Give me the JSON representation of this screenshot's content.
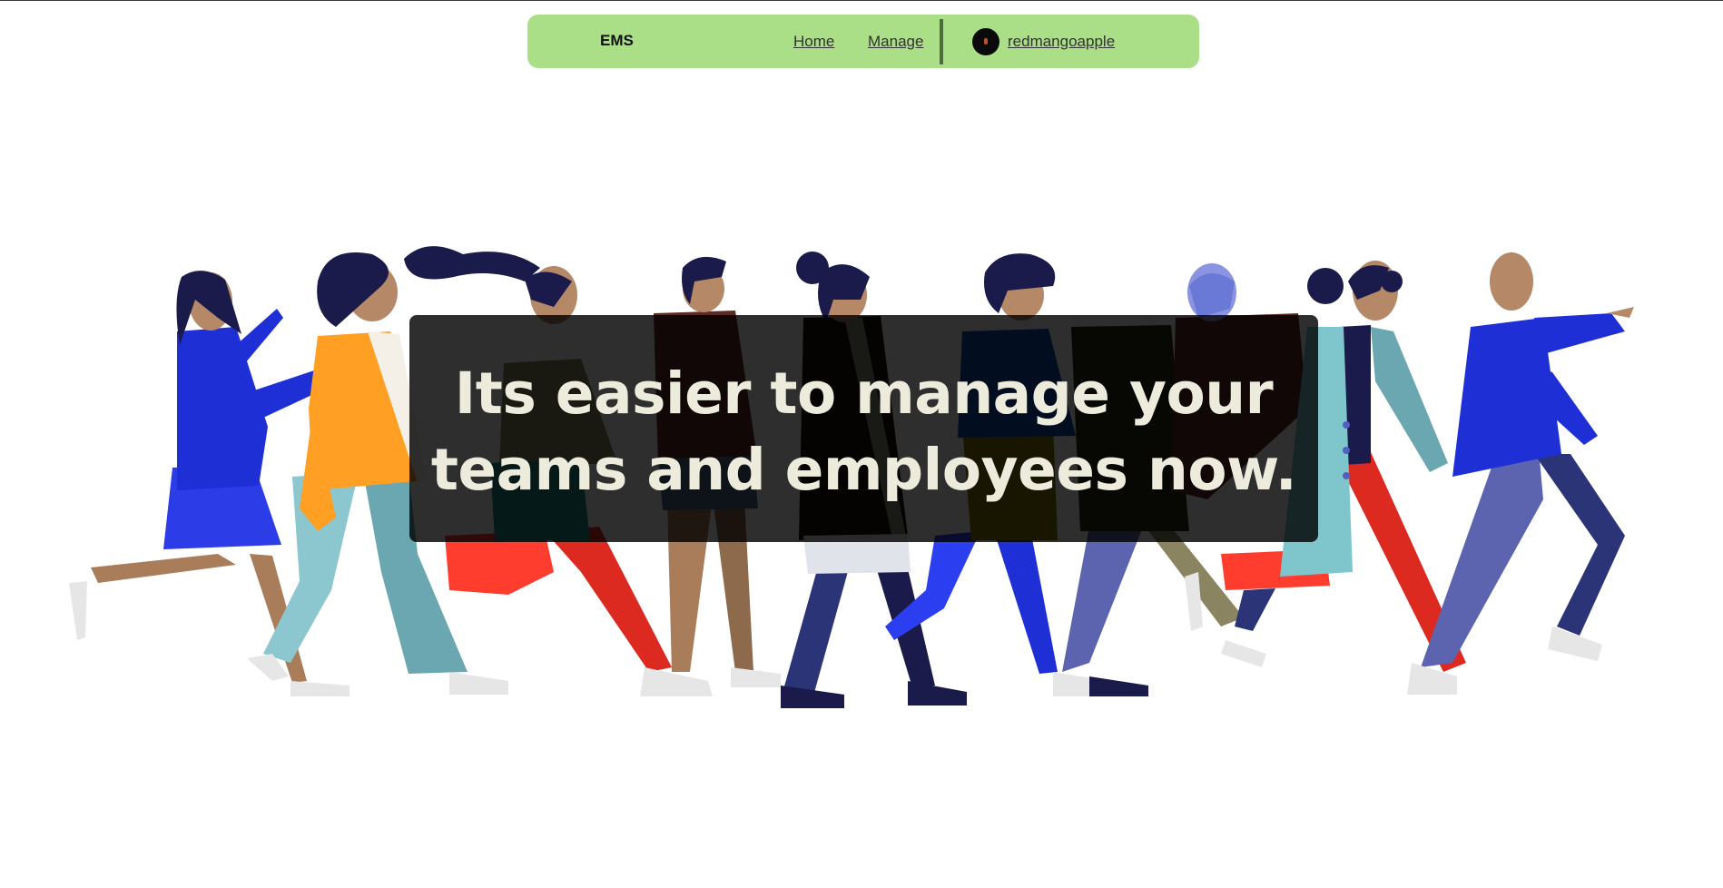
{
  "nav": {
    "brand": "EMS",
    "links": [
      {
        "label": "Home"
      },
      {
        "label": "Manage"
      }
    ],
    "user": {
      "name": "redmangoapple"
    }
  },
  "hero": {
    "headline": "Its easier to manage your teams and employees now."
  },
  "colors": {
    "nav_background": "#abdf87",
    "nav_divider": "#4d6c3c",
    "overlay": "#000000",
    "headline_text": "#ecebdc"
  }
}
